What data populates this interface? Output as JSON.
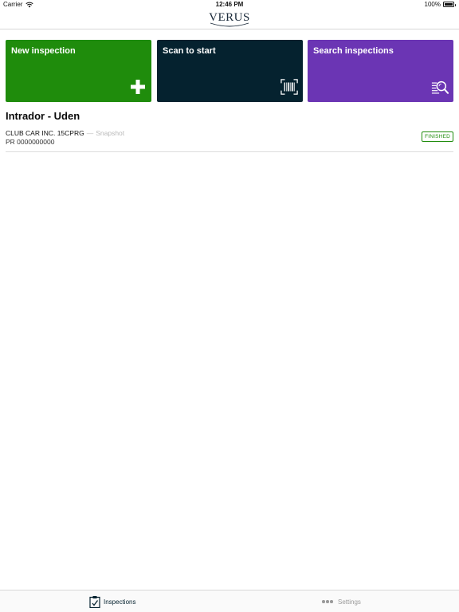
{
  "status_bar": {
    "carrier": "Carrier",
    "time": "12:46 PM",
    "battery": "100%"
  },
  "nav": {
    "logo_text": "VERUS"
  },
  "tiles": [
    {
      "label": "New inspection",
      "icon": "plus-icon",
      "color": "#1f8c0c"
    },
    {
      "label": "Scan to start",
      "icon": "barcode-scan-icon",
      "color": "#05222f"
    },
    {
      "label": "Search inspections",
      "icon": "search-list-icon",
      "color": "#6b35b4"
    }
  ],
  "section": {
    "title": "Intrador - Uden"
  },
  "inspections": [
    {
      "name": "CLUB CAR INC. 15CPRG",
      "separator": "—",
      "type": "Snapshot",
      "reference": "PR 0000000000",
      "status": "FINISHED",
      "status_color": "#1f8c0c"
    }
  ],
  "tab_bar": {
    "tabs": [
      {
        "label": "Inspections",
        "icon": "clipboard-check-icon",
        "active": true
      },
      {
        "label": "Settings",
        "icon": "more-dots-icon",
        "active": false
      }
    ]
  }
}
